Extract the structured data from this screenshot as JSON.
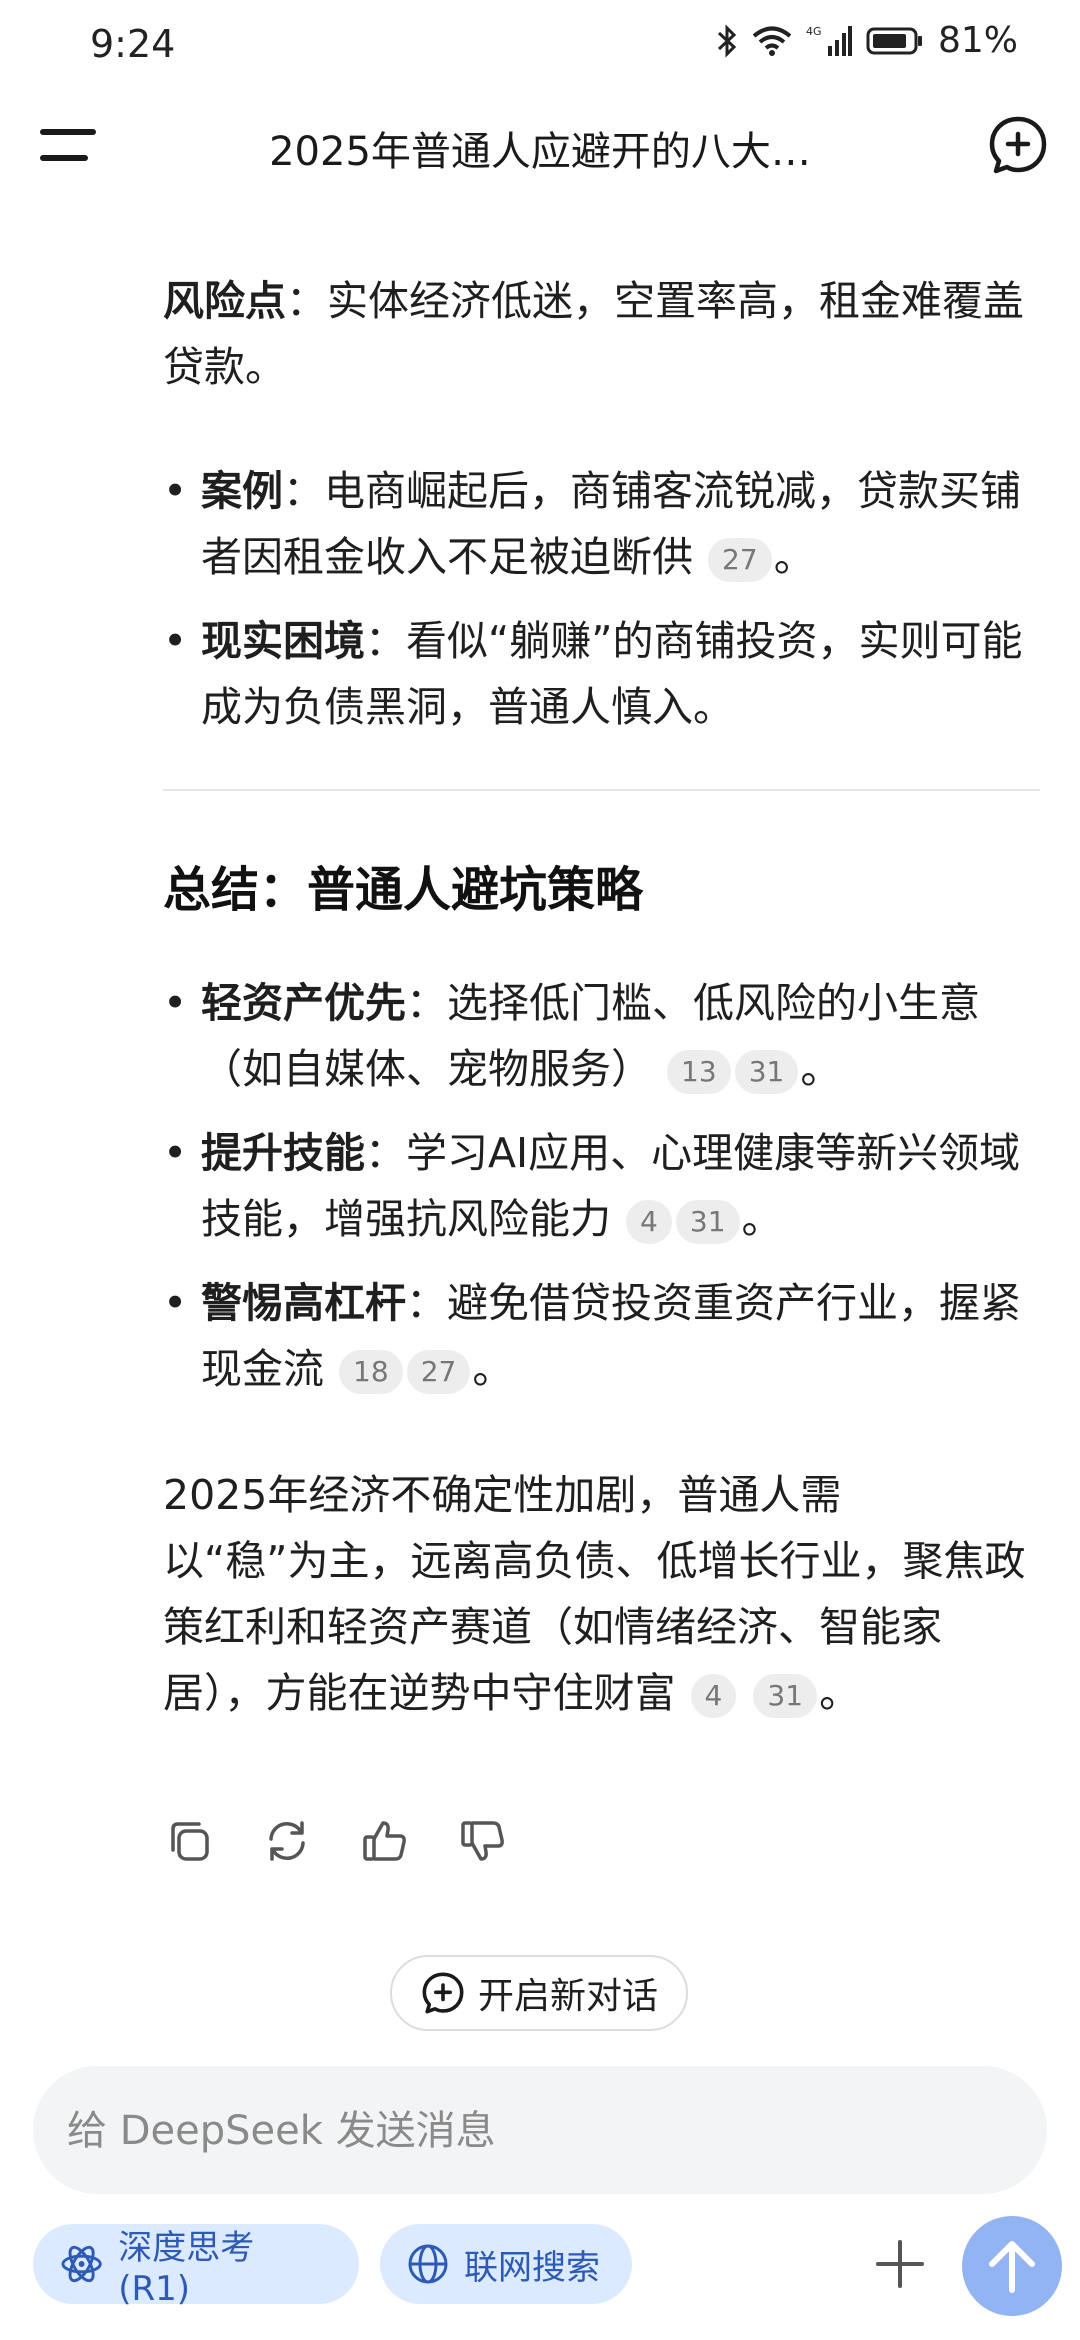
{
  "status": {
    "time": "9:24",
    "battery": "81%",
    "network": "4G"
  },
  "header": {
    "title": "2025年普通人应避开的八大…"
  },
  "section_risk": {
    "label": "风险点",
    "text": "：实体经济低迷，空置率高，租金难覆盖贷款。",
    "bullets": [
      {
        "label": "案例",
        "text": "：电商崛起后，商铺客流锐减，贷款买铺者因租金收入不足被迫断供",
        "cites": [
          "27"
        ],
        "end": "。"
      },
      {
        "label": "现实困境",
        "text": "：看似“躺赚”的商铺投资，实则可能成为负债黑洞，普通人慎入。",
        "cites": [],
        "end": ""
      }
    ]
  },
  "summary": {
    "heading": "总结：普通人避坑策略",
    "bullets": [
      {
        "label": "轻资产优先",
        "text": "：选择低门槛、低风险的小生意（如自媒体、宠物服务）",
        "cites": [
          "13",
          "31"
        ],
        "end": "。"
      },
      {
        "label": "提升技能",
        "text": "：学习AI应用、心理健康等新兴领域技能，增强抗风险能力",
        "cites": [
          "4",
          "31"
        ],
        "end": "。"
      },
      {
        "label": "警惕高杠杆",
        "text": "：避免借贷投资重资产行业，握紧现金流",
        "cites": [
          "18",
          "27"
        ],
        "end": "。"
      }
    ],
    "conclusion": {
      "line1": "2025年经济不确定性加剧，普通人需",
      "rest": "以“稳”为主，远离高负债、低增长行业，聚焦政策红利和轻资产赛道（如情绪经济、智能家居），方能在逆势中守住财富",
      "cites": [
        "4",
        "31"
      ],
      "end": "。"
    }
  },
  "actions": {
    "icons": [
      "copy-icon",
      "regenerate-icon",
      "thumbs-up-icon",
      "thumbs-down-icon"
    ]
  },
  "new_conversation": {
    "label": "开启新对话"
  },
  "input": {
    "placeholder": "给 DeepSeek 发送消息"
  },
  "toolbar": {
    "deep_think": "深度思考 (R1)",
    "web_search": "联网搜索"
  },
  "colors": {
    "chip_bg": "#dbeafe",
    "chip_text": "#2d5ab5",
    "send_bg": "#93b4f3",
    "cite_bg": "#ededed"
  }
}
